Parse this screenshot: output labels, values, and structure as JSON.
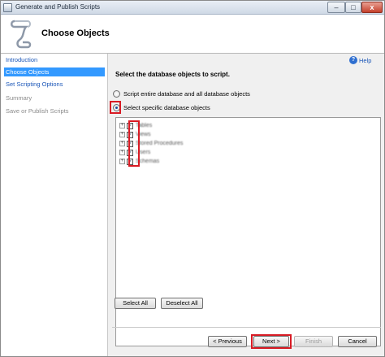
{
  "window": {
    "title": "Generate and Publish Scripts",
    "minimize_label": "–",
    "maximize_label": "□",
    "close_label": "x"
  },
  "header": {
    "page_title": "Choose Objects"
  },
  "nav": {
    "items": [
      {
        "label": "Introduction",
        "state": "link"
      },
      {
        "label": "Choose Objects",
        "state": "selected"
      },
      {
        "label": "Set Scripting Options",
        "state": "link"
      },
      {
        "label": "Summary",
        "state": "disabled"
      },
      {
        "label": "Save or Publish Scripts",
        "state": "disabled"
      }
    ]
  },
  "main": {
    "help_label": "Help",
    "help_icon_glyph": "?",
    "instruction": "Select the database objects to script.",
    "radio_options": [
      {
        "label": "Script entire database and all database objects",
        "checked": false
      },
      {
        "label": "Select specific database objects",
        "checked": true
      }
    ],
    "tree": {
      "expander_glyph": "+",
      "check_glyph": "✓",
      "items": [
        {
          "label": "Tables",
          "checked": true
        },
        {
          "label": "Views",
          "checked": true
        },
        {
          "label": "Stored Procedures",
          "checked": true
        },
        {
          "label": "Users",
          "checked": true
        },
        {
          "label": "Schemas",
          "checked": true
        }
      ]
    },
    "select_all_label": "Select All",
    "deselect_all_label": "Deselect All"
  },
  "footer": {
    "previous_label": "< Previous",
    "next_label": "Next >",
    "finish_label": "Finish",
    "cancel_label": "Cancel"
  },
  "colors": {
    "highlight_red": "#d81b24",
    "nav_selected": "#3399ff",
    "link_blue": "#1a56b8"
  }
}
